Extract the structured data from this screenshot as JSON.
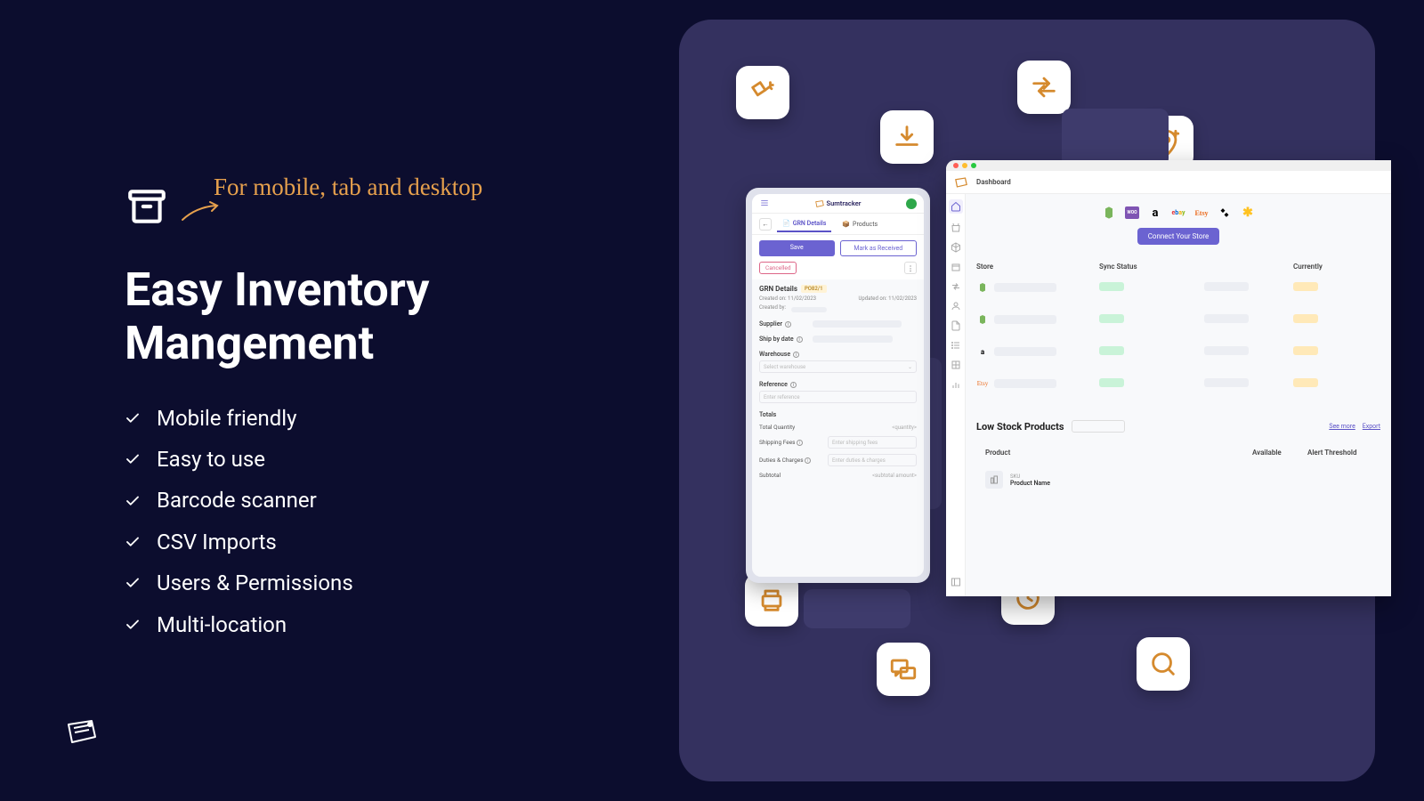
{
  "handnote": "For mobile, tab and desktop",
  "heading_l1": "Easy Inventory",
  "heading_l2": "Mangement",
  "features": [
    "Mobile friendly",
    "Easy to use",
    "Barcode scanner",
    "CSV Imports",
    "Users & Permissions",
    "Multi-location"
  ],
  "mobile": {
    "brand": "Sumtracker",
    "tab_grn": "GRN Details",
    "tab_products": "Products",
    "save": "Save",
    "mark": "Mark as Received",
    "cancelled": "Cancelled",
    "sec_title": "GRN Details",
    "po_badge": "PO82/1",
    "created_on_lbl": "Created on:",
    "created_on_val": "11/02/2023",
    "updated_on_lbl": "Updated on:",
    "updated_on_val": "11/02/2023",
    "created_by_lbl": "Created by:",
    "supplier_lbl": "Supplier",
    "ship_lbl": "Ship by date",
    "warehouse_lbl": "Warehouse",
    "warehouse_ph": "Select warehouse",
    "reference_lbl": "Reference",
    "reference_ph": "Enter reference",
    "totals_lbl": "Totals",
    "total_qty_lbl": "Total Quantity",
    "total_qty_val": "<quantity>",
    "shipping_lbl": "Shipping Fees",
    "shipping_ph": "Enter shipping fees",
    "duties_lbl": "Duties & Charges",
    "duties_ph": "Enter duties & charges",
    "subtotal_lbl": "Subtotal",
    "subtotal_val": "<subtotal amount>"
  },
  "desktop": {
    "title": "Dashboard",
    "cta": "Connect Your Store",
    "th_store": "Store",
    "th_sync": "Sync Status",
    "th_curr": "Currently",
    "stores": [
      "shopify",
      "shopify",
      "amazon",
      "etsy"
    ],
    "low_title": "Low Stock Products",
    "see_more": "See more",
    "export": "Export",
    "low_th_prod": "Product",
    "low_th_avail": "Available",
    "low_th_alert": "Alert Threshold",
    "prod_sku": "SKU",
    "prod_name": "Product Name"
  }
}
